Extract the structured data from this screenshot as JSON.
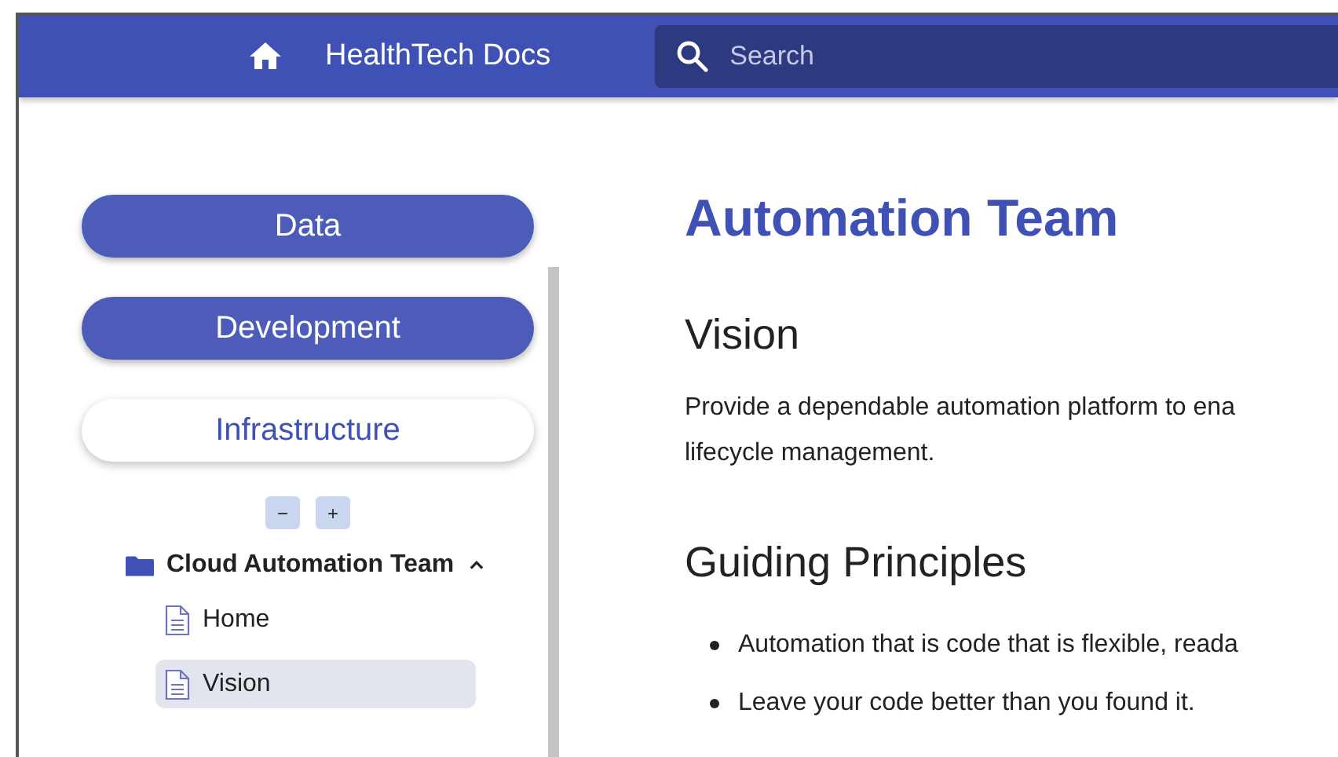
{
  "header": {
    "title": "HealthTech Docs",
    "search": {
      "placeholder": "Search"
    }
  },
  "sidebar": {
    "sections": [
      {
        "label": "Data",
        "selected": false
      },
      {
        "label": "Development",
        "selected": false
      },
      {
        "label": "Infrastructure",
        "selected": true
      }
    ],
    "tree_controls": [
      "−",
      "+"
    ],
    "tree": [
      {
        "label": "Cloud Automation Team",
        "expanded": true,
        "children": [
          {
            "label": "Home",
            "selected": false
          },
          {
            "label": "Vision",
            "selected": true
          }
        ]
      }
    ]
  },
  "content": {
    "title": "Automation Team",
    "sections": [
      {
        "heading": "Vision",
        "paragraph": [
          "Provide a dependable automation platform to ena",
          "lifecycle management."
        ]
      },
      {
        "heading": "Guiding Principles",
        "bullets": [
          "Automation that is code that is flexible, reada",
          "Leave your code better than you found it."
        ]
      }
    ]
  }
}
